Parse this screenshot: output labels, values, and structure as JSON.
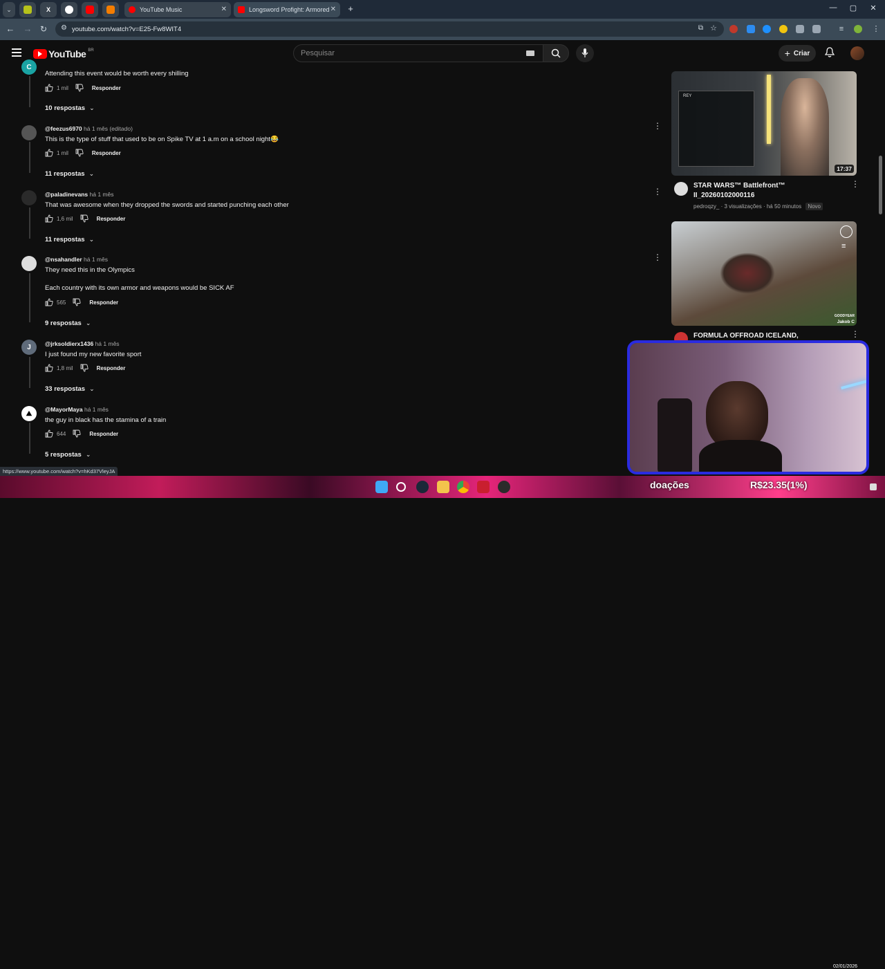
{
  "browser": {
    "tabs": [
      {
        "label": "YouTube Music",
        "color": "#ff0000"
      },
      {
        "label": "Longsword Profight: Armored",
        "color": "#ff0000"
      }
    ],
    "url": "youtube.com/watch?v=E25-Fw8WIT4",
    "status_url": "https://www.youtube.com/watch?v=hKd37VleyJA"
  },
  "youtube": {
    "logo_text": "YouTube",
    "region": "BR",
    "search_placeholder": "Pesquisar",
    "create_label": "Criar"
  },
  "comments": [
    {
      "author": "",
      "time": "",
      "text": "Attending this event would be worth every shilling",
      "likes": "1 mil",
      "reply_label": "Responder",
      "replies": "10 respostas",
      "avatar_letter": "C",
      "avatar_color": "#1aa3a3"
    },
    {
      "author": "@feezus6970",
      "time": "há 1 mês (editado)",
      "text": "This is the type of stuff that used to be on Spike TV at 1 a.m on a school night😂",
      "likes": "1 mil",
      "reply_label": "Responder",
      "replies": "11 respostas",
      "avatar_letter": "",
      "avatar_color": "#555555"
    },
    {
      "author": "@paladinevans",
      "time": "há 1 mês",
      "text": "That was awesome when they dropped the swords and started punching each other",
      "likes": "1,6 mil",
      "reply_label": "Responder",
      "replies": "11 respostas",
      "avatar_letter": "",
      "avatar_color": "#333333"
    },
    {
      "author": "@nsahandler",
      "time": "há 1 mês",
      "text": "They need this in the Olympics",
      "text2": "Each country with its own armor and weapons would be SICK AF",
      "likes": "565",
      "reply_label": "Responder",
      "replies": "9 respostas",
      "avatar_letter": "",
      "avatar_color": "#dddddd"
    },
    {
      "author": "@jrksoldierx1436",
      "time": "há 1 mês",
      "text": "I just found my new favorite sport",
      "likes": "1,8 mil",
      "reply_label": "Responder",
      "replies": "33 respostas",
      "avatar_letter": "J",
      "avatar_color": "#5f6b7a"
    },
    {
      "author": "@MayorMaya",
      "time": "há 1 mês",
      "text": "the guy in black has the stamina of a train",
      "likes": "644",
      "reply_label": "Responder",
      "replies": "5 respostas",
      "avatar_letter": "",
      "avatar_color": "#ffffff"
    }
  ],
  "recommended": [
    {
      "title": "STAR WARS™ Battlefront™ II_20260102000116",
      "channel": "pedroqzy_",
      "views": "3 visualizações",
      "age": "há 50 minutos",
      "badge": "Novo",
      "duration": "17:37",
      "thumb_label": "REY"
    },
    {
      "title": "FORMULA OFFROAD ICELAND, AKUREYRI",
      "thumb_label": "GOODYEAR",
      "thumb_label2": "Jakob C"
    }
  ],
  "overlay": {
    "donations_label": "doações",
    "donations_value": "R$23.35(1%)"
  },
  "taskbar": {
    "clock": "02/01/2026"
  }
}
